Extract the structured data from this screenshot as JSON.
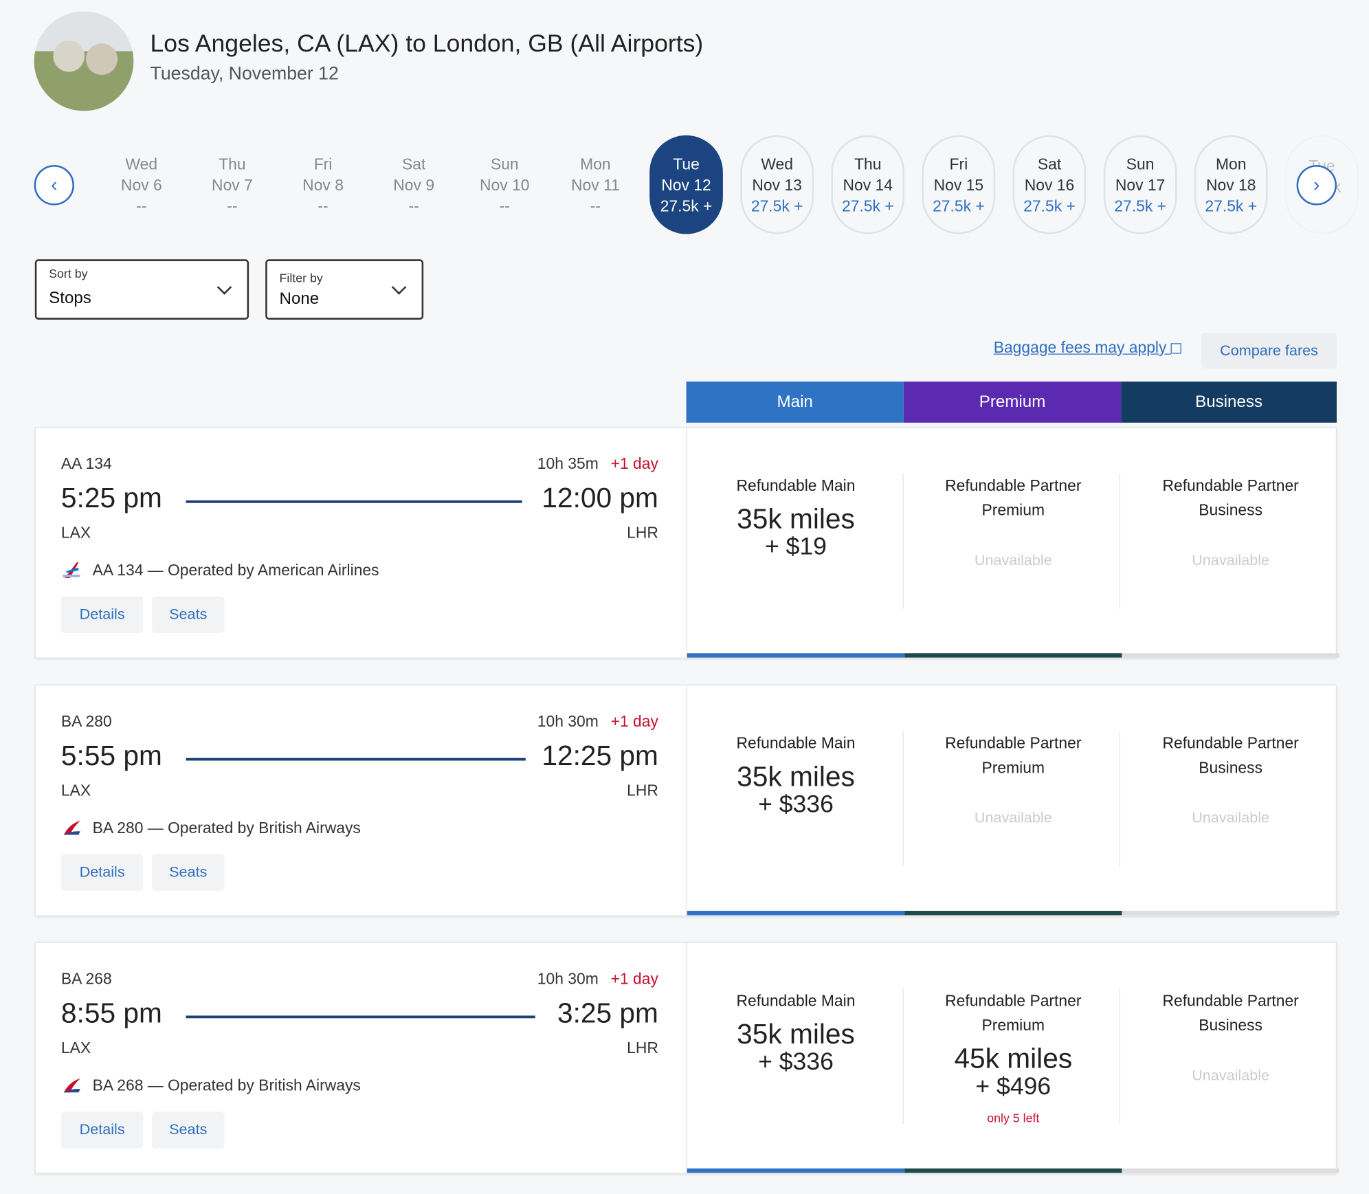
{
  "header": {
    "title": "Los Angeles, CA (LAX) to London, GB (All Airports)",
    "subtitle": "Tuesday, November 12",
    "avatar": "sheep-photo"
  },
  "dates": [
    {
      "day": "Wed",
      "date": "Nov 6",
      "price": "--",
      "state": "past"
    },
    {
      "day": "Thu",
      "date": "Nov 7",
      "price": "--",
      "state": "past"
    },
    {
      "day": "Fri",
      "date": "Nov 8",
      "price": "--",
      "state": "past"
    },
    {
      "day": "Sat",
      "date": "Nov 9",
      "price": "--",
      "state": "past"
    },
    {
      "day": "Sun",
      "date": "Nov 10",
      "price": "--",
      "state": "past"
    },
    {
      "day": "Mon",
      "date": "Nov 11",
      "price": "--",
      "state": "past"
    },
    {
      "day": "Tue",
      "date": "Nov 12",
      "price": "27.5k +",
      "state": "sel"
    },
    {
      "day": "Wed",
      "date": "Nov 13",
      "price": "27.5k +",
      "state": "future"
    },
    {
      "day": "Thu",
      "date": "Nov 14",
      "price": "27.5k +",
      "state": "future"
    },
    {
      "day": "Fri",
      "date": "Nov 15",
      "price": "27.5k +",
      "state": "future"
    },
    {
      "day": "Sat",
      "date": "Nov 16",
      "price": "27.5k +",
      "state": "future"
    },
    {
      "day": "Sun",
      "date": "Nov 17",
      "price": "27.5k +",
      "state": "future"
    },
    {
      "day": "Mon",
      "date": "Nov 18",
      "price": "27.5k +",
      "state": "future"
    },
    {
      "day": "Tue",
      "date": "",
      "price": "27.5k",
      "state": "ghost"
    }
  ],
  "controls": {
    "sort_label": "Sort by",
    "sort_value": "Stops",
    "filter_label": "Filter by",
    "filter_value": "None",
    "baggage": "Baggage fees may apply",
    "compare": "Compare fares"
  },
  "tabs": [
    {
      "label": "Main",
      "color": "#2f73c4"
    },
    {
      "label": "Premium",
      "color": "#5b2ab0"
    },
    {
      "label": "Business",
      "color": "#143c62"
    }
  ],
  "labels": {
    "details": "Details",
    "seats": "Seats",
    "plus_day": "+1 day",
    "unavailable": "Unavailable"
  },
  "flights": [
    {
      "number": "AA 134",
      "duration": "10h 35m",
      "depart": "5:25 pm",
      "arrive": "12:00 pm",
      "from": "LAX",
      "to": "LHR",
      "operated": "AA 134 — Operated by American Airlines",
      "airline": "aa",
      "fares": [
        {
          "label": "Refundable Main",
          "miles": "35k miles",
          "price": "+ $19"
        },
        {
          "label": "Refundable Partner Premium",
          "miles": null,
          "price": null
        },
        {
          "label": "Refundable Partner Business",
          "miles": null,
          "price": null
        }
      ]
    },
    {
      "number": "BA 280",
      "duration": "10h 30m",
      "depart": "5:55 pm",
      "arrive": "12:25 pm",
      "from": "LAX",
      "to": "LHR",
      "operated": "BA 280 — Operated by British Airways",
      "airline": "ba",
      "fares": [
        {
          "label": "Refundable Main",
          "miles": "35k miles",
          "price": "+ $336"
        },
        {
          "label": "Refundable Partner Premium",
          "miles": null,
          "price": null
        },
        {
          "label": "Refundable Partner Business",
          "miles": null,
          "price": null
        }
      ]
    },
    {
      "number": "BA 268",
      "duration": "10h 30m",
      "depart": "8:55 pm",
      "arrive": "3:25 pm",
      "from": "LAX",
      "to": "LHR",
      "operated": "BA 268 — Operated by British Airways",
      "airline": "ba",
      "fares": [
        {
          "label": "Refundable Main",
          "miles": "35k miles",
          "price": "+ $336"
        },
        {
          "label": "Refundable Partner Premium",
          "miles": "45k miles",
          "price": "+ $496",
          "note": "only 5 left"
        },
        {
          "label": "Refundable Partner Business",
          "miles": null,
          "price": null
        }
      ]
    }
  ]
}
